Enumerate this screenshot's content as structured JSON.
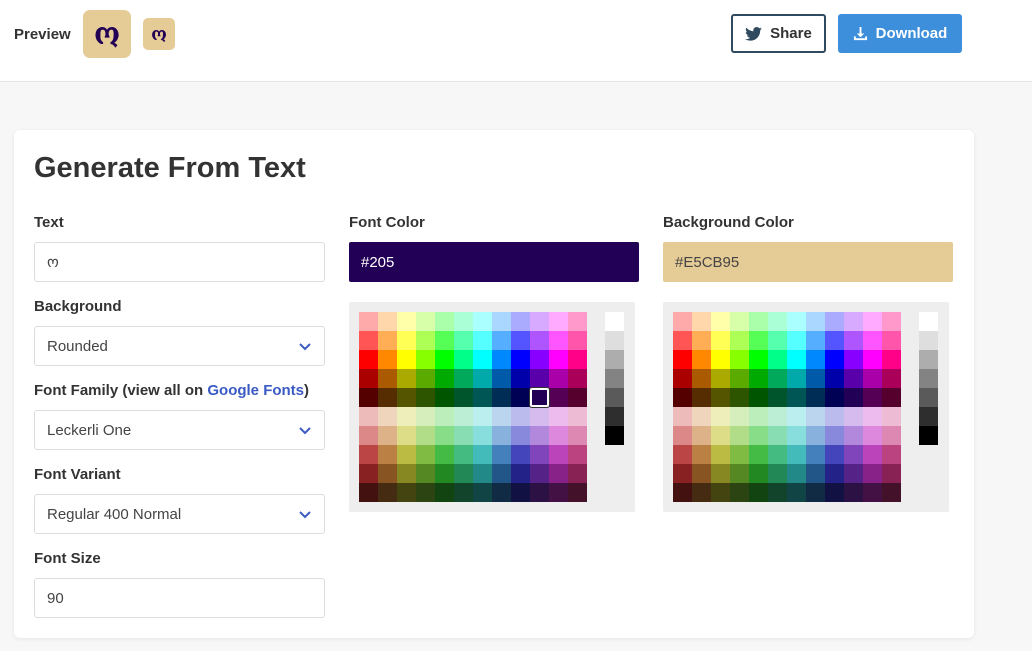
{
  "preview": {
    "label": "Preview",
    "glyph": "ო"
  },
  "actions": {
    "share_label": "Share",
    "download_label": "Download"
  },
  "card": {
    "title": "Generate From Text",
    "text": {
      "label": "Text",
      "value": "ო"
    },
    "background": {
      "label": "Background",
      "value": "Rounded"
    },
    "font_family": {
      "label_prefix": "Font Family (view all on ",
      "link": "Google Fonts",
      "label_suffix": ")",
      "value": "Leckerli One"
    },
    "font_variant": {
      "label": "Font Variant",
      "value": "Regular 400 Normal"
    },
    "font_size": {
      "label": "Font Size",
      "value": "90"
    },
    "font_color": {
      "label": "Font Color",
      "value": "#205"
    },
    "background_color": {
      "label": "Background Color",
      "value": "#E5CB95"
    }
  },
  "colors": {
    "font_hex": "#220055",
    "background_hex": "#E5CB95",
    "accent": "#3d8edb",
    "link": "#3b5bc4"
  },
  "palette": {
    "grays": [
      "#ffffff",
      "#dedede",
      "#adadad",
      "#838383",
      "#5a5a5a",
      "#2e2e2e",
      "#000000"
    ],
    "rows": [
      [
        "#ffaaaa",
        "#ffd7aa",
        "#ffffaa",
        "#d7ffaa",
        "#aaffaa",
        "#aaffd7",
        "#aaffff",
        "#aad7ff",
        "#aaaaff",
        "#d7aaff",
        "#ffaaff",
        "#ff99cc"
      ],
      [
        "#ff5555",
        "#ffae55",
        "#ffff55",
        "#aeff55",
        "#55ff55",
        "#55ffae",
        "#55ffff",
        "#55aeff",
        "#5555ff",
        "#ae55ff",
        "#ff55ff",
        "#ff55aa"
      ],
      [
        "#ff0000",
        "#ff8800",
        "#ffff00",
        "#88ff00",
        "#00ff00",
        "#00ff88",
        "#00ffff",
        "#0088ff",
        "#0000ff",
        "#8800ff",
        "#ff00ff",
        "#ff0088"
      ],
      [
        "#aa0000",
        "#aa5a00",
        "#aaaa00",
        "#5aaa00",
        "#00aa00",
        "#00aa5a",
        "#00aaaa",
        "#005aaa",
        "#0000aa",
        "#5a00aa",
        "#aa00aa",
        "#aa005a"
      ],
      [
        "#550000",
        "#552d00",
        "#555500",
        "#2d5500",
        "#005500",
        "#00552d",
        "#005555",
        "#002d55",
        "#000055",
        "#220055",
        "#550055",
        "#55002d"
      ],
      [
        "#eebbbb",
        "#eed5bb",
        "#eeeebb",
        "#d5eebb",
        "#bbeebb",
        "#bbeed5",
        "#bbeeee",
        "#bbd5ee",
        "#bbbbee",
        "#d5bbee",
        "#eebbee",
        "#eebbd5"
      ],
      [
        "#dd8888",
        "#ddb288",
        "#dddd88",
        "#b2dd88",
        "#88dd88",
        "#88ddb2",
        "#88dddd",
        "#88b2dd",
        "#8888dd",
        "#b288dd",
        "#dd88dd",
        "#dd88b2"
      ],
      [
        "#bb4444",
        "#bb8044",
        "#bbbb44",
        "#80bb44",
        "#44bb44",
        "#44bb80",
        "#44bbbb",
        "#4480bb",
        "#4444bb",
        "#8044bb",
        "#bb44bb",
        "#bb4480"
      ],
      [
        "#882222",
        "#885522",
        "#888822",
        "#558822",
        "#228822",
        "#228855",
        "#228888",
        "#225588",
        "#222288",
        "#552288",
        "#882288",
        "#882255"
      ],
      [
        "#441111",
        "#442b11",
        "#444411",
        "#2b4411",
        "#114411",
        "#11442b",
        "#114444",
        "#112b44",
        "#111144",
        "#2b1144",
        "#441144",
        "#44112b"
      ]
    ]
  }
}
